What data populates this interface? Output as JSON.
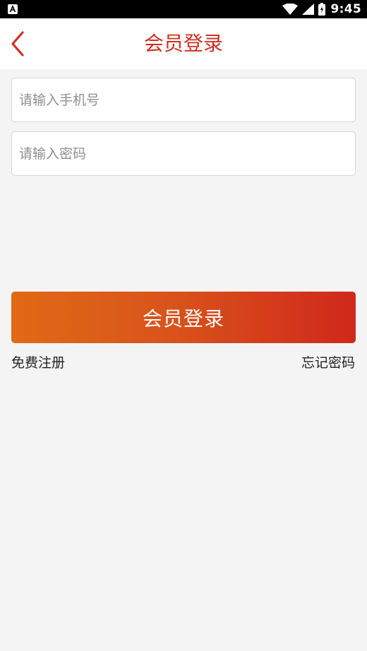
{
  "status_bar": {
    "time": "9:45",
    "icons": [
      "app-notification-icon",
      "wifi-icon",
      "signal-icon",
      "battery-icon"
    ]
  },
  "header": {
    "title": "会员登录",
    "back_icon": "chevron-left-icon"
  },
  "form": {
    "phone_placeholder": "请输入手机号",
    "phone_value": "",
    "password_placeholder": "请输入密码",
    "password_value": ""
  },
  "login_button_label": "会员登录",
  "links": {
    "register": "免费注册",
    "forgot_password": "忘记密码"
  },
  "colors": {
    "accent": "#cf2f22",
    "button_gradient_start": "#e06a16",
    "button_gradient_end": "#d0281b",
    "background": "#f4f4f4"
  }
}
